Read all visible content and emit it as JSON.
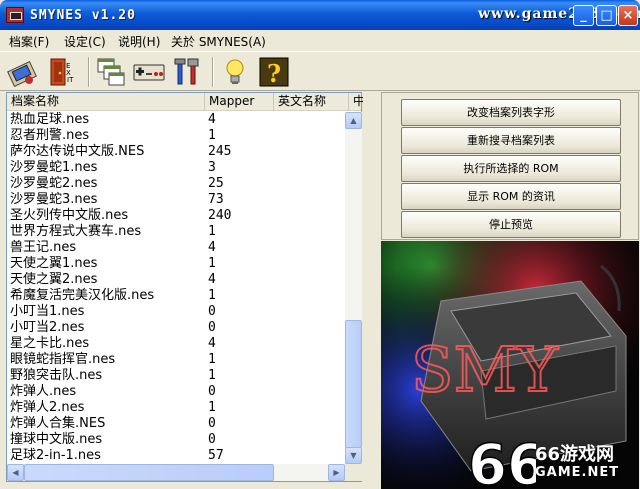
{
  "window": {
    "title": "SMYNES v1.20",
    "watermark_url": "www.game2233.com",
    "controls": {
      "minimize": "_",
      "maximize": "□",
      "close": "×"
    }
  },
  "menu": {
    "items": [
      {
        "label": "档案(F)"
      },
      {
        "label": "设定(C)"
      },
      {
        "label": "说明(H)"
      },
      {
        "label": "关於 SMYNES(A)"
      }
    ]
  },
  "toolbar": {
    "buttons": [
      {
        "icon": "open-rom-icon"
      },
      {
        "icon": "exit-door-icon"
      },
      {
        "icon": "windows-icon"
      },
      {
        "icon": "gamepad-icon"
      },
      {
        "icon": "tools-icon"
      },
      {
        "icon": "lightbulb-icon"
      },
      {
        "icon": "help-question-icon"
      }
    ]
  },
  "list": {
    "columns": [
      "档案名称",
      "Mapper",
      "英文名称",
      "中"
    ],
    "rows": [
      {
        "name": "热血足球.nes",
        "mapper": "4"
      },
      {
        "name": "忍者刑警.nes",
        "mapper": "1"
      },
      {
        "name": "萨尔达传说中文版.NES",
        "mapper": "245"
      },
      {
        "name": "沙罗曼蛇1.nes",
        "mapper": "3"
      },
      {
        "name": "沙罗曼蛇2.nes",
        "mapper": "25"
      },
      {
        "name": "沙罗曼蛇3.nes",
        "mapper": "73"
      },
      {
        "name": "圣火列传中文版.nes",
        "mapper": "240"
      },
      {
        "name": "世界方程式大赛车.nes",
        "mapper": "1"
      },
      {
        "name": "兽王记.nes",
        "mapper": "4"
      },
      {
        "name": "天使之翼1.nes",
        "mapper": "1"
      },
      {
        "name": "天使之翼2.nes",
        "mapper": "4"
      },
      {
        "name": "希魔复活完美汉化版.nes",
        "mapper": "1"
      },
      {
        "name": "小叮当1.nes",
        "mapper": "0"
      },
      {
        "name": "小叮当2.nes",
        "mapper": "0"
      },
      {
        "name": "星之卡比.nes",
        "mapper": "4"
      },
      {
        "name": "眼镜蛇指挥官.nes",
        "mapper": "1"
      },
      {
        "name": "野狼突击队.nes",
        "mapper": "1"
      },
      {
        "name": "炸弹人.nes",
        "mapper": "0"
      },
      {
        "name": "炸弹人2.nes",
        "mapper": "1"
      },
      {
        "name": "炸弹人合集.NES",
        "mapper": "0"
      },
      {
        "name": "撞球中文版.nes",
        "mapper": "0"
      },
      {
        "name": "足球2-in-1.nes",
        "mapper": "57"
      }
    ],
    "scrollbar": {
      "up": "▲",
      "down": "▼",
      "left": "◀",
      "right": "▶"
    }
  },
  "actions": {
    "change_font": "改变档案列表字形",
    "rescan": "重新搜寻档案列表",
    "run_selected": "执行所选择的 ROM",
    "show_info": "显示 ROM 的资讯",
    "stop_preview": "停止预览"
  },
  "preview": {
    "logo_text": "SMY"
  },
  "watermark": {
    "digits": "66",
    "site": "66游戏网",
    "sub": "GAME.NET"
  }
}
